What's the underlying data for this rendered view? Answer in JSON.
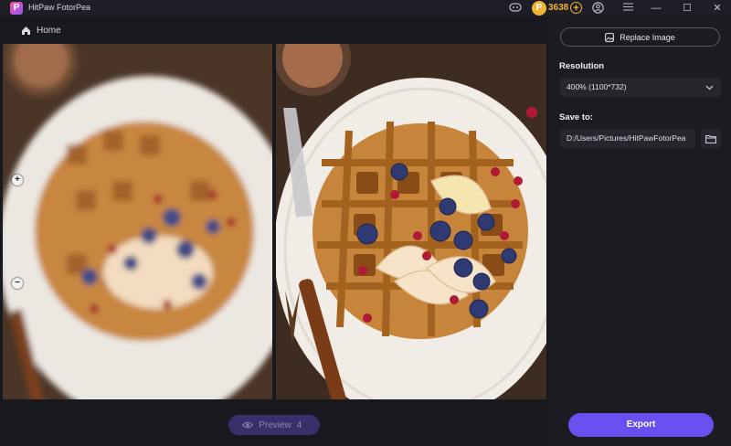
{
  "app": {
    "title": "HitPaw FotorPea",
    "logo_letter": "P"
  },
  "titlebar": {
    "discord_icon": "discord-icon",
    "coin_symbol": "P",
    "coins": "3638",
    "plus": "+",
    "user_icon": "user-icon",
    "menu_icon": "hamburger-icon",
    "minimize": "—",
    "maximize": "☐",
    "close": "✕"
  },
  "nav": {
    "home_label": "Home"
  },
  "zoom": {
    "in": "+",
    "out": "−"
  },
  "preview": {
    "label": "Preview",
    "count": "4"
  },
  "sidebar": {
    "replace_label": "Replace Image",
    "resolution_label": "Resolution",
    "resolution_value": "400% (1100*732)",
    "save_label": "Save to:",
    "save_path": "D:/Users/Pictures/HitPawFotorPea",
    "export_label": "Export"
  },
  "colors": {
    "accent": "#6a4ff0",
    "coin": "#f2b233"
  }
}
